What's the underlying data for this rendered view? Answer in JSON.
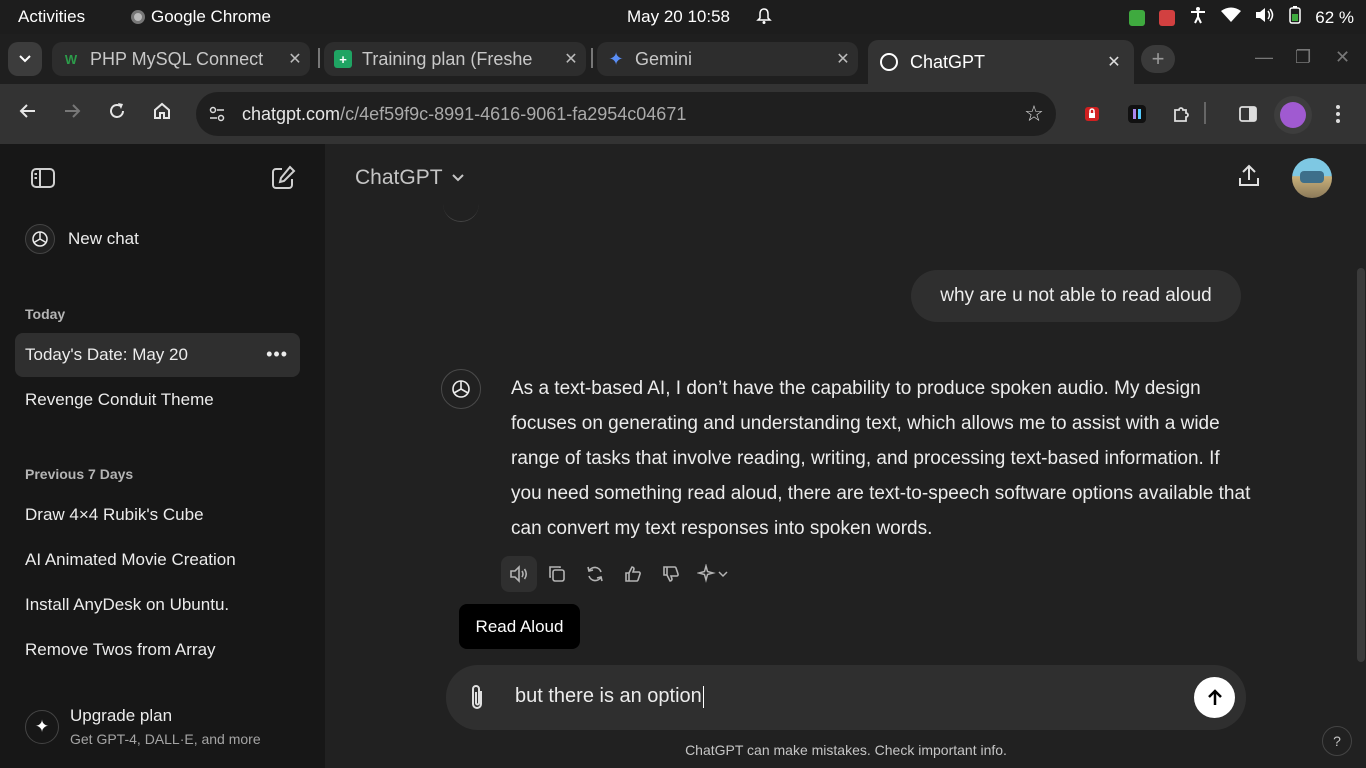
{
  "os": {
    "activities": "Activities",
    "app": "Google Chrome",
    "datetime": "May 20  10:58",
    "battery": "62 %"
  },
  "tabs": [
    {
      "title": "PHP MySQL Connect",
      "icon": "w-favicon"
    },
    {
      "title": "Training plan (Freshe",
      "icon": "sheets-favicon"
    },
    {
      "title": "Gemini",
      "icon": "gemini-sparkle"
    }
  ],
  "active_tab": {
    "title": "ChatGPT",
    "icon": "openai-logo"
  },
  "omnibox": {
    "url_host": "chatgpt.com",
    "url_path": "/c/4ef59f9c-8991-4616-9061-fa2954c04671"
  },
  "sidebar": {
    "new_chat": "New chat",
    "today_label": "Today",
    "today_items": [
      "Today's Date: May 20",
      "Revenge Conduit Theme"
    ],
    "prev_label": "Previous 7 Days",
    "prev_items": [
      "Draw 4×4 Rubik's Cube",
      "AI Animated Movie Creation",
      "Install AnyDesk on Ubuntu.",
      "Remove Twos from Array"
    ],
    "upgrade_title": "Upgrade plan",
    "upgrade_sub": "Get GPT-4, DALL·E, and more"
  },
  "main": {
    "model": "ChatGPT",
    "user_message": "why are u not able to read aloud",
    "assistant_message": "As a text-based AI, I don’t have the capability to produce spoken audio. My design focuses on generating and understanding text, which allows me to assist with a wide range of tasks that involve reading, writing, and processing text-based information. If you need something read aloud, there are text-to-speech software options available that can convert my text responses into spoken words.",
    "tooltip": "Read Aloud",
    "composer_value": "but there is an option",
    "disclaimer": "ChatGPT can make mistakes. Check important info.",
    "help": "?"
  },
  "colors": {
    "sidebar_bg": "#171717",
    "main_bg": "#212121",
    "bubble_bg": "#2f2f2f"
  }
}
